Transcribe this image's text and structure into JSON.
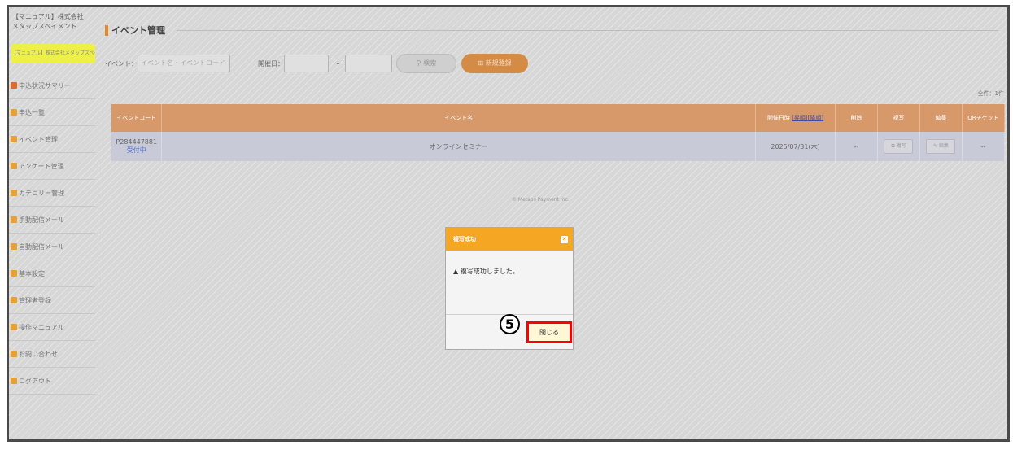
{
  "sidebar": {
    "company_line1": "【マニュアル】株式会社",
    "company_line2": "メタップスペイメント",
    "manual_button": "【マニュアル】株式会社メタップスペイメント",
    "items": [
      {
        "label": "申込状況サマリー",
        "icon_color": "#e06a2a",
        "icon": "chart-icon"
      },
      {
        "label": "申込一覧",
        "icon_color": "#e8a032",
        "icon": "list-icon"
      },
      {
        "label": "イベント管理",
        "icon_color": "#e8a032",
        "icon": "calendar-icon"
      },
      {
        "label": "アンケート管理",
        "icon_color": "#e8a032",
        "icon": "survey-icon"
      },
      {
        "label": "カテゴリー管理",
        "icon_color": "#e8a032",
        "icon": "category-icon"
      },
      {
        "label": "手動配信メール",
        "icon_color": "#e8a032",
        "icon": "rss-icon"
      },
      {
        "label": "自動配信メール",
        "icon_color": "#e8a032",
        "icon": "mail-icon"
      },
      {
        "label": "基本設定",
        "icon_color": "#e8a032",
        "icon": "gear-icon"
      },
      {
        "label": "管理者登録",
        "icon_color": "#e8a032",
        "icon": "user-icon"
      },
      {
        "label": "操作マニュアル",
        "icon_color": "#e8a032",
        "icon": "help-icon"
      },
      {
        "label": "お問い合わせ",
        "icon_color": "#e8a032",
        "icon": "contact-icon"
      },
      {
        "label": "ログアウト",
        "icon_color": "#e8a032",
        "icon": "logout-icon"
      }
    ]
  },
  "header": {
    "title": "イベント管理"
  },
  "filter": {
    "event_label": "イベント：",
    "event_placeholder": "イベント名・イベントコード",
    "date_label": "開催日：",
    "tilde": "～",
    "search_button": "検索",
    "new_button": "新規登録"
  },
  "count_text": "全件：1件",
  "table": {
    "headers": {
      "code": "イベントコード",
      "name": "イベント名",
      "date_prefix": "開催日時",
      "date_asc": "[昇順]",
      "date_desc": "[降順]",
      "delete": "削除",
      "copy": "複写",
      "edit": "編集",
      "qr": "QRチケット"
    },
    "rows": [
      {
        "code": "P284447881",
        "status": "受付中",
        "name": "オンラインセミナー",
        "date": "2025/07/31(木)",
        "delete": "--",
        "copy": "複写",
        "edit": "編集",
        "qr": "--"
      }
    ]
  },
  "footer": {
    "copyright": "© Metaps Payment Inc."
  },
  "dialog": {
    "title": "複写成功",
    "message": "複写成功しました。",
    "close_button": "閉じる"
  },
  "annotation": {
    "step": "5"
  }
}
